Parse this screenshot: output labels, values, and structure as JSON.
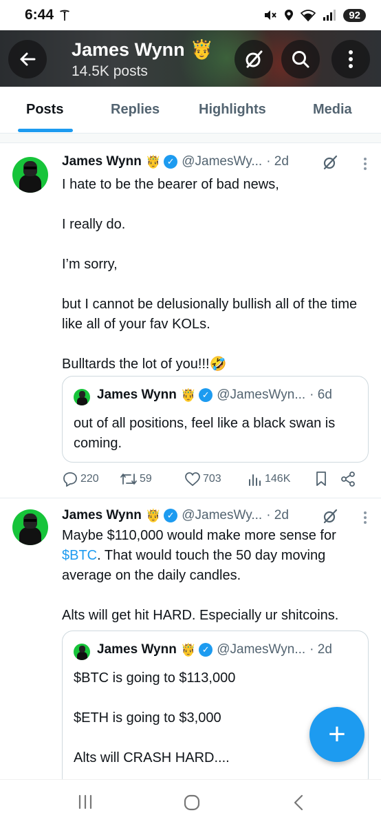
{
  "status_bar": {
    "time": "6:44",
    "battery": "92"
  },
  "header": {
    "title": "James Wynn",
    "crown": "🤴",
    "subtitle": "14.5K posts"
  },
  "tabs": [
    {
      "label": "Posts",
      "active": true
    },
    {
      "label": "Replies",
      "active": false
    },
    {
      "label": "Highlights",
      "active": false
    },
    {
      "label": "Media",
      "active": false
    }
  ],
  "posts": [
    {
      "name": "James Wynn",
      "crown": "🤴",
      "handle": "@JamesWy...",
      "time": "· 2d",
      "text": "I hate to be the bearer of bad news,\n\nI really do.\n\nI’m sorry,\n\nbut I cannot be delusionally bullish all of the time like all of your fav KOLs.\n\nBulltards the lot of you!!!🤣",
      "quote": {
        "name": "James Wynn",
        "crown": "🤴",
        "handle": "@JamesWyn...",
        "time": "· 6d",
        "text": "out of all positions, feel like a black swan is coming."
      },
      "actions": {
        "replies": "220",
        "reposts": "59",
        "likes": "703",
        "views": "146K"
      }
    },
    {
      "name": "James Wynn",
      "crown": "🤴",
      "handle": "@JamesWy...",
      "time": "· 2d",
      "text_before": "Maybe $110,000 would make more sense for ",
      "cashtag": "$BTC",
      "text_after": ". That would touch the 50 day moving average on the daily candles.\n\nAlts will get hit HARD. Especially ur shitcoins.",
      "quote": {
        "name": "James Wynn",
        "crown": "🤴",
        "handle": "@JamesWyn...",
        "time": "· 2d",
        "text": "$BTC is going to $113,000\n\n$ETH is going to $3,000\n\nAlts will CRASH HARD...."
      }
    }
  ],
  "fab": {
    "label": "+"
  },
  "icons": [
    "tesla-icon",
    "mute-icon",
    "location-icon",
    "wifi-icon",
    "signal-icon",
    "back-arrow-icon",
    "grok-icon",
    "search-icon",
    "more-vertical-icon",
    "verified-icon",
    "reply-icon",
    "repost-icon",
    "like-icon",
    "views-icon",
    "bookmark-icon",
    "share-icon",
    "recents-icon",
    "home-icon",
    "back-icon"
  ],
  "colors": {
    "accent": "#1d9bf0",
    "avatar_bg": "#17c43a",
    "text": "#0f1419",
    "muted": "#536471"
  }
}
